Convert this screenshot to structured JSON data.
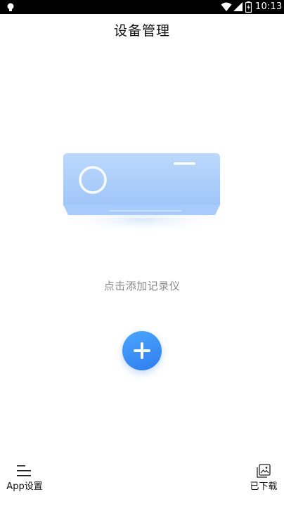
{
  "status_bar": {
    "time": "10:13",
    "icons": [
      "notification-icon",
      "wifi-icon",
      "signal-icon",
      "battery-icon"
    ]
  },
  "header": {
    "title": "设备管理"
  },
  "main": {
    "illustration": "air-conditioner-icon",
    "empty_hint": "点击添加记录仪",
    "add_button_icon": "plus-icon"
  },
  "bottom_nav": {
    "left": {
      "label": "App设置",
      "icon": "menu-icon"
    },
    "right": {
      "label": "已下载",
      "icon": "gallery-icon"
    }
  },
  "colors": {
    "accent": "#2f7cf0",
    "accent_light": "#4aa8ff",
    "illustration_blue": "#a9cdfb",
    "hint_text": "#8a8a8a"
  }
}
